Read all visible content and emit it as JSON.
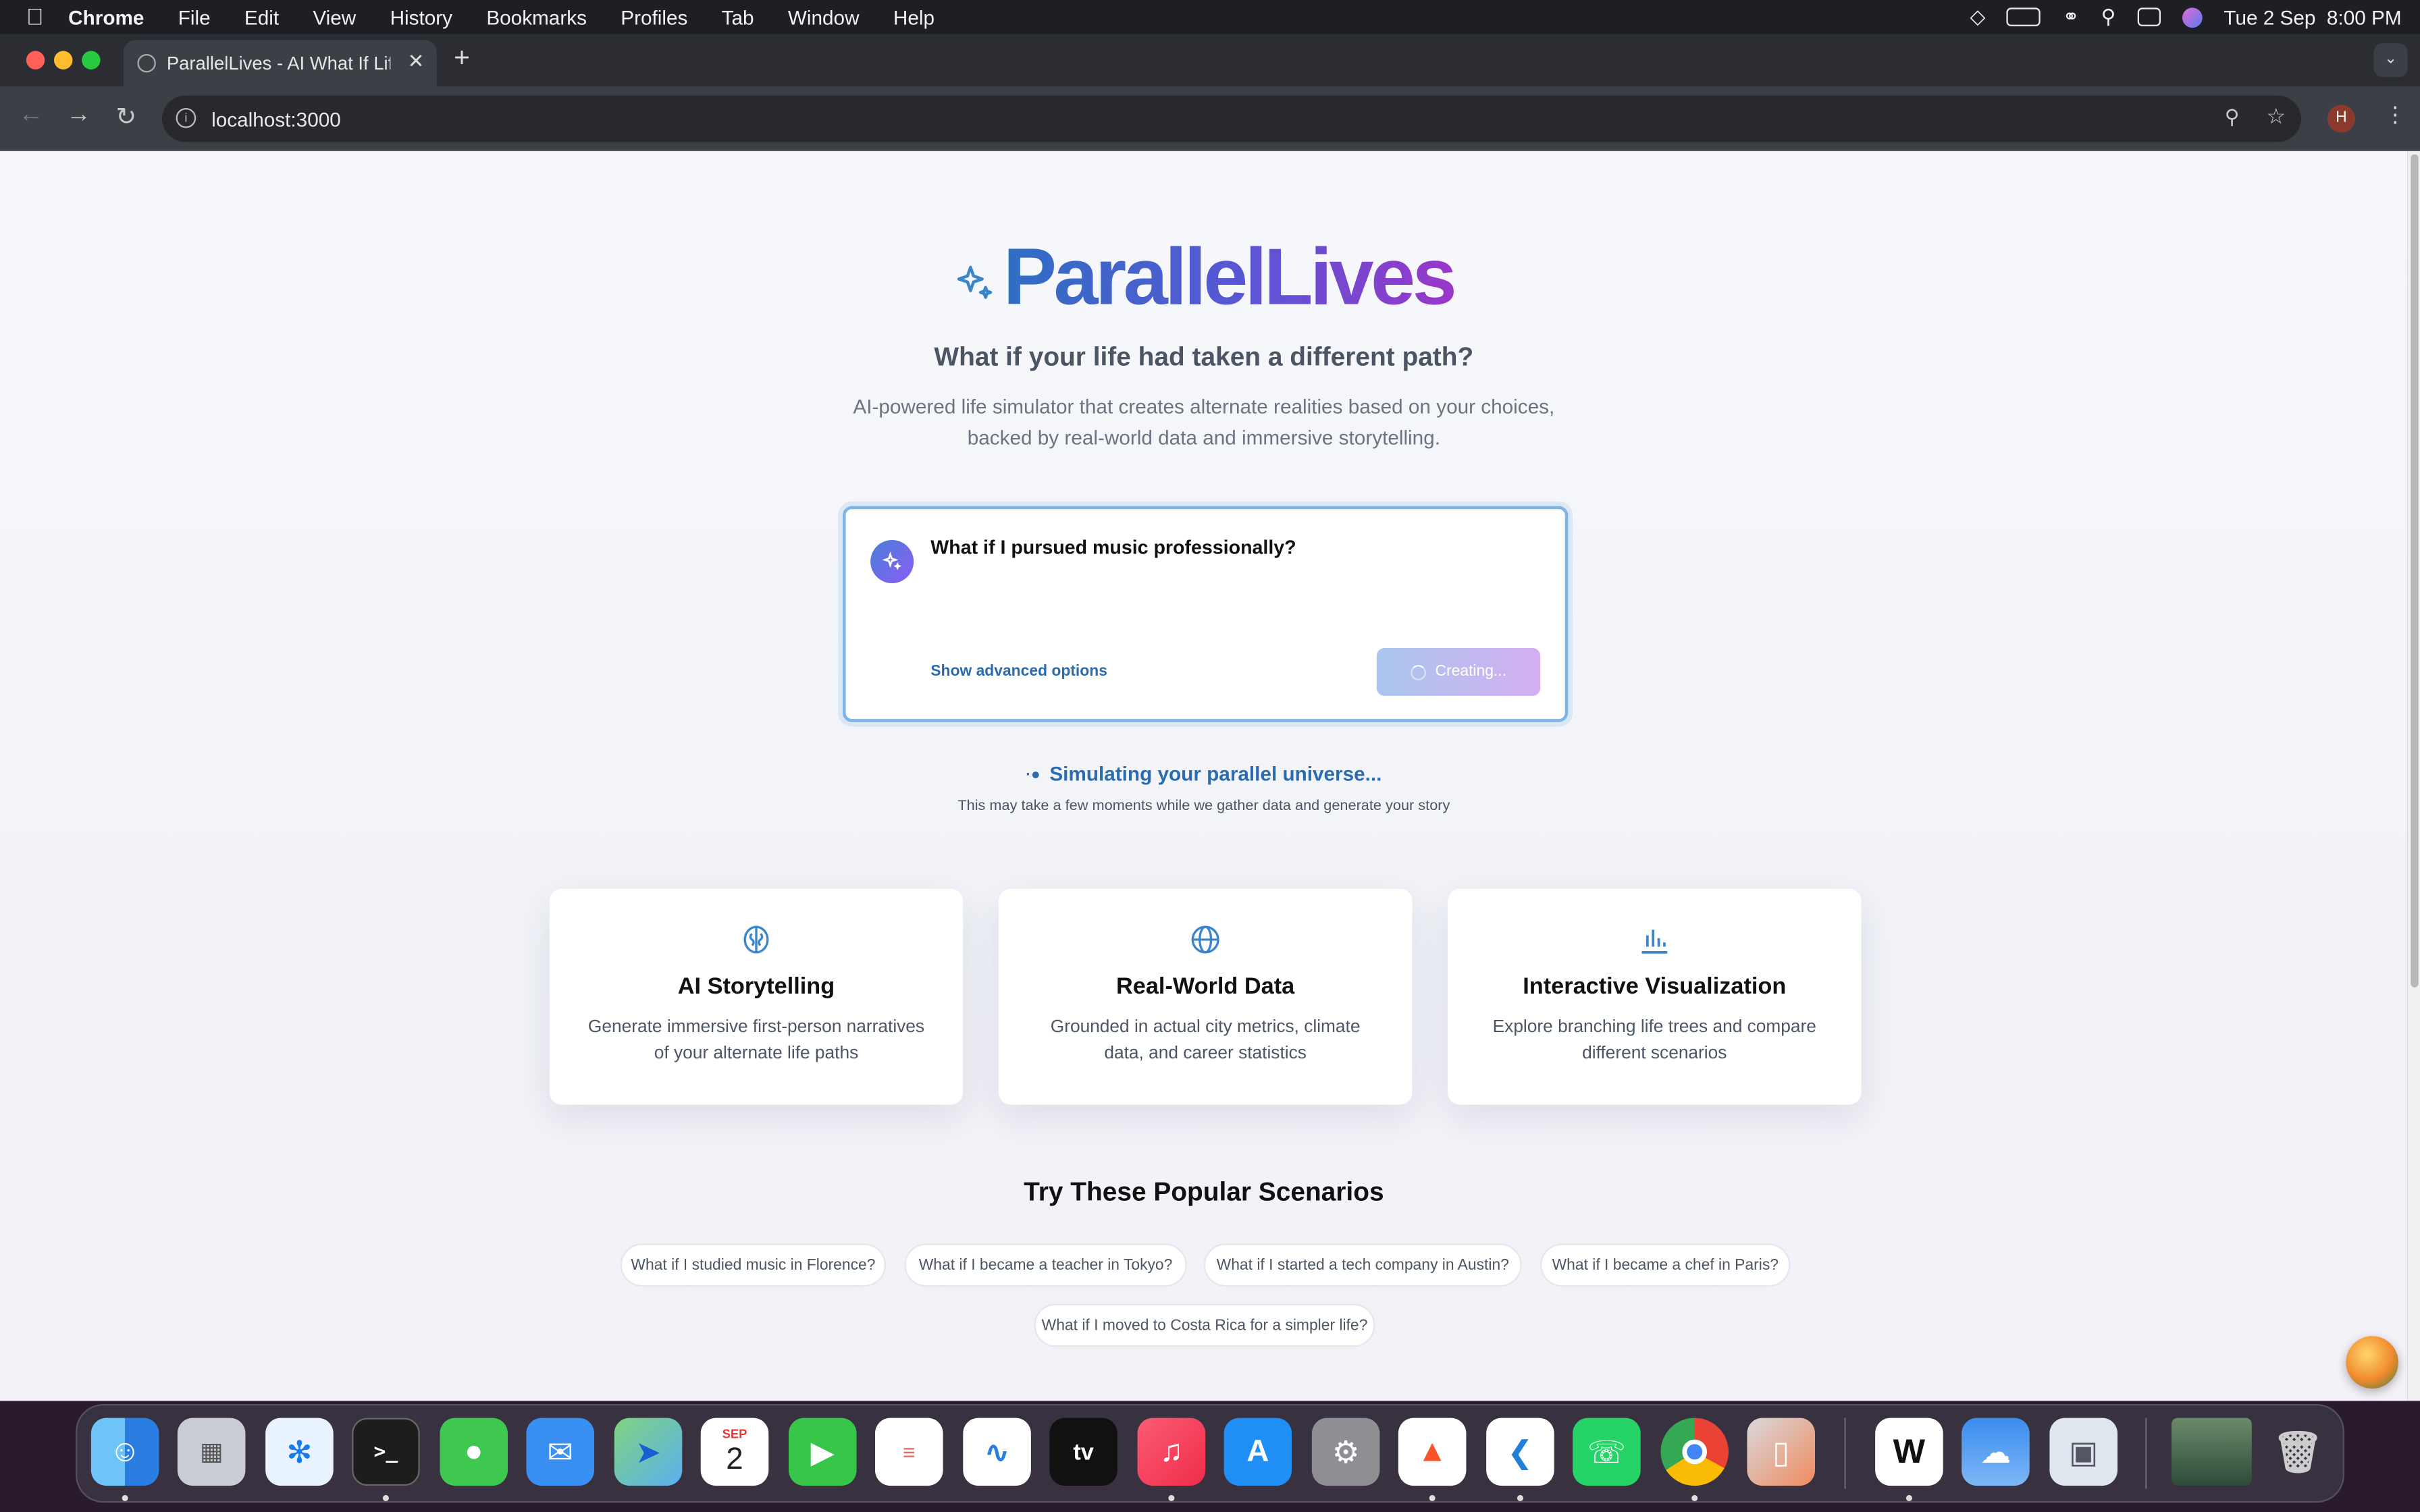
{
  "menubar": {
    "app": "Chrome",
    "items": [
      "File",
      "Edit",
      "View",
      "History",
      "Bookmarks",
      "Profiles",
      "Tab",
      "Window",
      "Help"
    ],
    "datetime": "Tue 2 Sep  8:00 PM"
  },
  "browser": {
    "tab_title": "ParallelLives - AI What If Life S",
    "url": "localhost:3000",
    "profile_initial": "H"
  },
  "hero": {
    "logo": "ParallelLives",
    "headline": "What if your life had taken a different path?",
    "description_1": "AI-powered life simulator that creates alternate realities based on your choices,",
    "description_2": "backed by real-world data and immersive storytelling."
  },
  "prompt": {
    "value": "What if I pursued music professionally?",
    "advanced_link": "Show advanced options",
    "submit_label": "Creating..."
  },
  "status": {
    "title": "Simulating your parallel universe...",
    "subtitle": "This may take a few moments while we gather data and generate your story"
  },
  "features": [
    {
      "icon": "brain-icon",
      "title": "AI Storytelling",
      "desc_1": "Generate immersive first-person narratives",
      "desc_2": "of your alternate life paths"
    },
    {
      "icon": "globe-icon",
      "title": "Real-World Data",
      "desc_1": "Grounded in actual city metrics, climate",
      "desc_2": "data, and career statistics"
    },
    {
      "icon": "bar-chart-icon",
      "title": "Interactive Visualization",
      "desc_1": "Explore branching life trees and compare",
      "desc_2": "different scenarios"
    }
  ],
  "scenarios": {
    "heading": "Try These Popular Scenarios",
    "items": [
      "What if I studied music in Florence?",
      "What if I became a teacher in Tokyo?",
      "What if I started a tech company in Austin?",
      "What if I became a chef in Paris?",
      "What if I moved to Costa Rica for a simpler life?"
    ]
  },
  "dock": {
    "calendar_month": "SEP",
    "calendar_day": "2",
    "tv_label": "tv"
  },
  "colors": {
    "brand_blue": "#2f6fc2",
    "brand_purple": "#9a37c9",
    "link": "#2b6cb0"
  }
}
